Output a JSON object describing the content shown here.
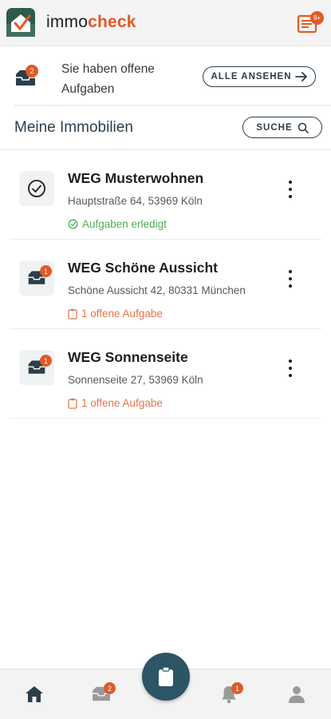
{
  "app": {
    "brand_part1": "immo",
    "brand_part2": "check",
    "header_badge": "9+"
  },
  "tasks_banner": {
    "badge_count": "2",
    "text": "Sie haben offene Aufgaben",
    "all_button_label": "ALLE ANSEHEN"
  },
  "section": {
    "title": "Meine Immobilien",
    "search_label": "SUCHE"
  },
  "properties": [
    {
      "name": "WEG Musterwohnen",
      "address": "Hauptstraße 64, 53969 Köln",
      "status": "Aufgaben erledigt",
      "status_type": "done",
      "icon": "check-circle-icon",
      "badge": ""
    },
    {
      "name": "WEG Schöne Aussicht",
      "address": "Schöne Aussicht 42, 80331 München",
      "status": "1 offene Aufgabe",
      "status_type": "open",
      "icon": "inbox-icon",
      "badge": "1"
    },
    {
      "name": "WEG Sonnenseite",
      "address": "Sonnenseite 27, 53969 Köln",
      "status": "1 offene Aufgabe",
      "status_type": "open",
      "icon": "inbox-icon",
      "badge": "1"
    }
  ],
  "bottom_nav": {
    "inbox_badge": "2",
    "notifications_badge": "1"
  },
  "colors": {
    "accent": "#e05a26",
    "primary": "#2c3e4a",
    "fab": "#2c5566",
    "done": "#4caf50",
    "open": "#e8744a"
  }
}
